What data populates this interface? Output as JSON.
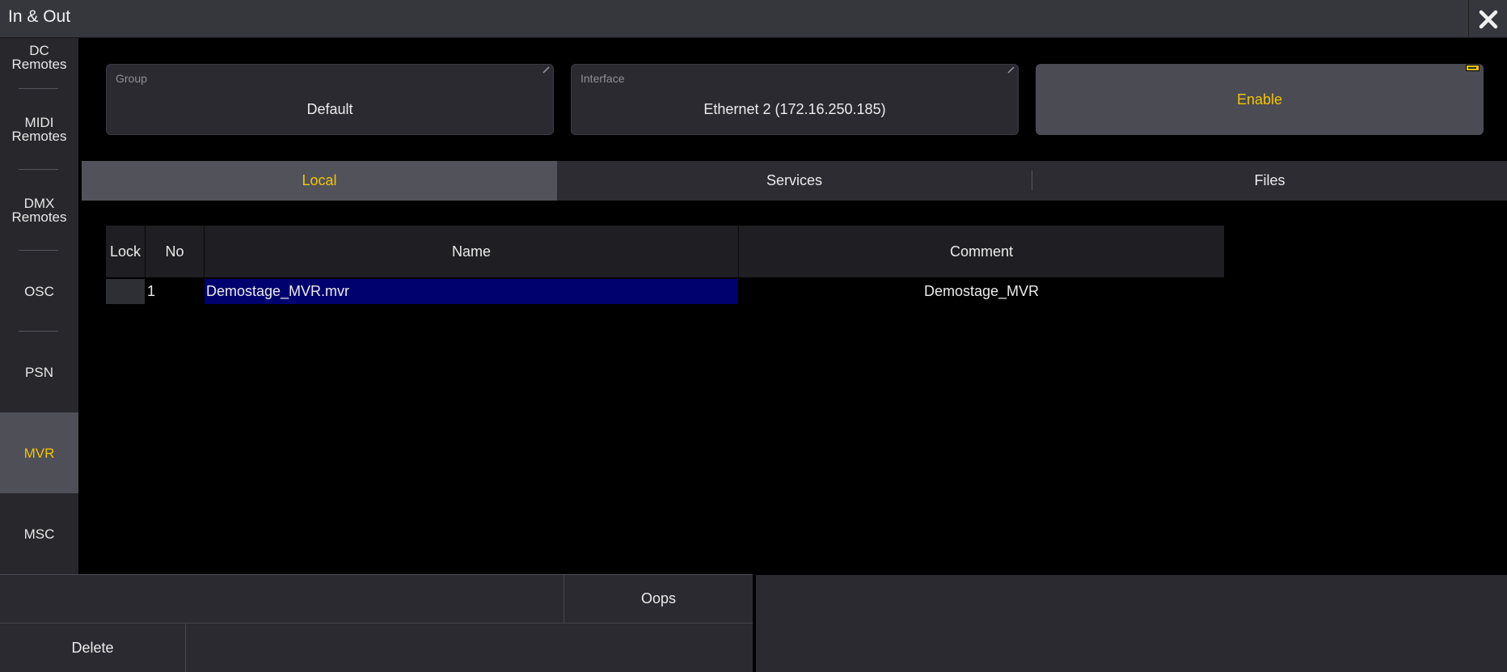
{
  "window": {
    "title": "In & Out"
  },
  "sidebar": {
    "items": [
      {
        "label": "DC\nRemotes"
      },
      {
        "label": "MIDI\nRemotes"
      },
      {
        "label": "DMX\nRemotes"
      },
      {
        "label": "OSC"
      },
      {
        "label": "PSN"
      },
      {
        "label": "MVR"
      },
      {
        "label": "MSC"
      }
    ],
    "active": "MVR"
  },
  "fields": {
    "group": {
      "label": "Group",
      "value": "Default"
    },
    "interface": {
      "label": "Interface",
      "value": "Ethernet 2 (172.16.250.185)"
    }
  },
  "enable_button": {
    "label": "Enable"
  },
  "tabs": [
    {
      "label": "Local",
      "active": true
    },
    {
      "label": "Services",
      "active": false
    },
    {
      "label": "Files",
      "active": false
    }
  ],
  "table": {
    "headers": {
      "lock": "Lock",
      "no": "No",
      "name": "Name",
      "comment": "Comment"
    },
    "rows": [
      {
        "lock": "",
        "no": "1",
        "name": "Demostage_MVR.mvr",
        "comment": "Demostage_MVR"
      }
    ]
  },
  "bottom": {
    "oops_label": "Oops",
    "delete_label": "Delete"
  },
  "colors": {
    "accent": "#f2c600",
    "selection": "#00006e",
    "panel": "#2a2a30"
  }
}
